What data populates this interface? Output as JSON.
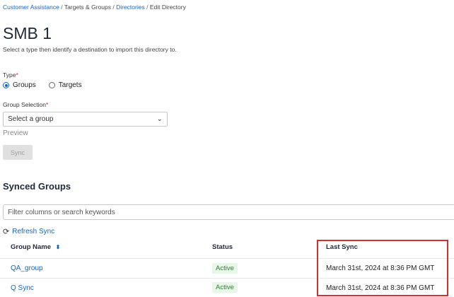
{
  "breadcrumb": {
    "items": [
      "Customer Assistance",
      "Targets & Groups",
      "Directories",
      "Edit Directory"
    ],
    "separator": "/"
  },
  "page": {
    "title": "SMB 1",
    "subtitle": "Select a type then identify a destination to import this directory to."
  },
  "type_field": {
    "label": "Type",
    "required_mark": "*",
    "options": [
      "Groups",
      "Targets"
    ],
    "selected": "Groups"
  },
  "group_selection": {
    "label": "Group Selection",
    "required_mark": "*",
    "placeholder": "Select a group"
  },
  "preview_label": "Preview",
  "sync_button": "Sync",
  "synced_groups": {
    "title": "Synced Groups",
    "filter_placeholder": "Filter columns or search keywords",
    "refresh_label": "Refresh Sync",
    "columns": [
      "Group Name",
      "Status",
      "Last Sync"
    ],
    "rows": [
      {
        "name": "QA_group",
        "status": "Active",
        "last_sync": "March 31st, 2024 at 8:36 PM GMT"
      },
      {
        "name": "Q Sync",
        "status": "Active",
        "last_sync": "March 31st, 2024 at 8:36 PM GMT"
      }
    ]
  },
  "colors": {
    "link": "#1565c0",
    "highlight_border": "#d32f2f",
    "status_active": "#2e7d32"
  }
}
